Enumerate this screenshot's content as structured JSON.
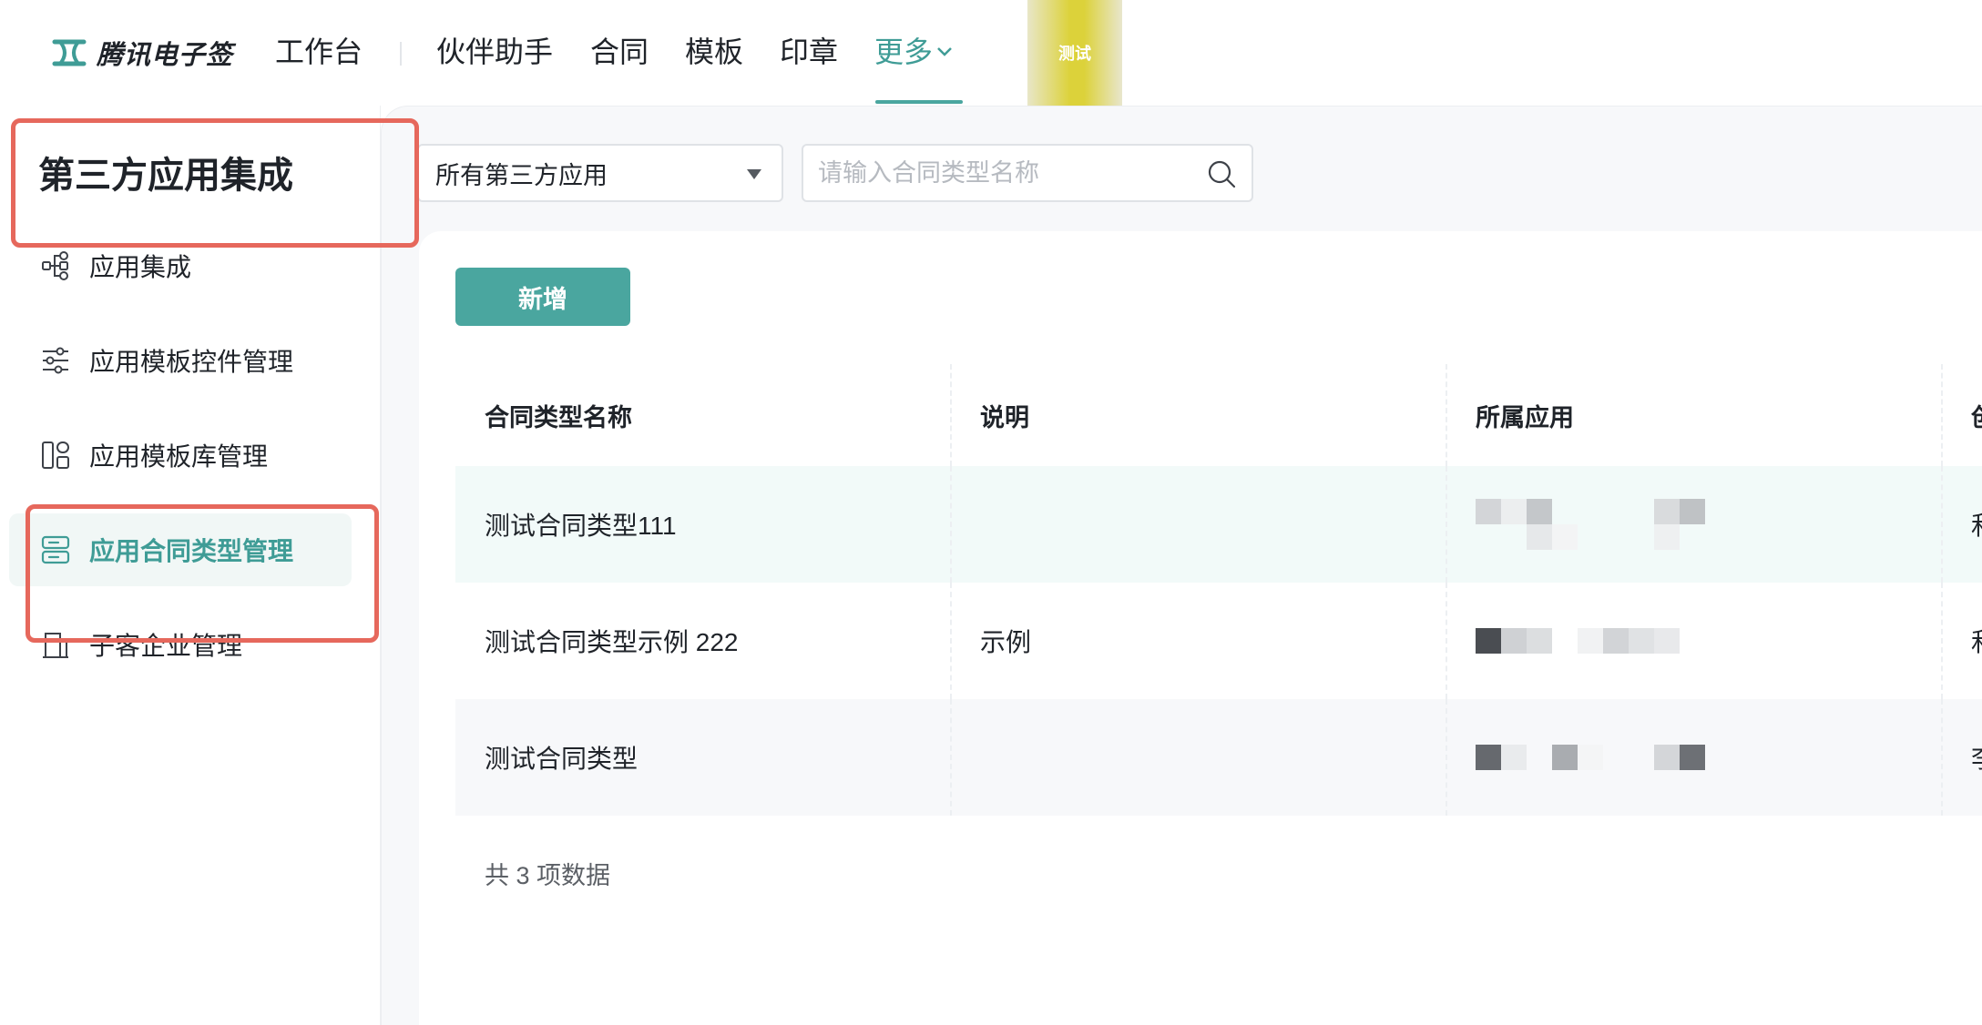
{
  "brand": {
    "name": "腾讯电子签"
  },
  "nav": {
    "items": [
      {
        "label": "工作台"
      },
      {
        "label": "伙伴助手"
      },
      {
        "label": "合同"
      },
      {
        "label": "模板"
      },
      {
        "label": "印章"
      },
      {
        "label": "更多"
      }
    ],
    "active": "更多",
    "badge": "测试"
  },
  "sidebar": {
    "title": "第三方应用集成",
    "items": [
      {
        "label": "应用集成",
        "icon": "integration-icon"
      },
      {
        "label": "应用模板控件管理",
        "icon": "sliders-icon"
      },
      {
        "label": "应用模板库管理",
        "icon": "template-library-icon"
      },
      {
        "label": "应用合同类型管理",
        "icon": "contract-type-icon",
        "active": true
      },
      {
        "label": "子客企业管理",
        "icon": "building-icon"
      }
    ]
  },
  "filters": {
    "app_select": "所有第三方应用",
    "search_placeholder": "请输入合同类型名称"
  },
  "toolbar": {
    "add_label": "新增"
  },
  "table": {
    "columns": [
      "合同类型名称",
      "说明",
      "所属应用",
      "创"
    ],
    "rows": [
      {
        "name": "测试合同类型111",
        "desc": "",
        "app_masked": true,
        "extra": "和"
      },
      {
        "name": "测试合同类型示例 222",
        "desc": "示例",
        "app_masked": true,
        "extra": "和"
      },
      {
        "name": "测试合同类型",
        "desc": "",
        "app_masked": true,
        "extra": "李"
      }
    ]
  },
  "footer": {
    "count_text": "共 3 项数据"
  },
  "colors": {
    "accent": "#4aa69f",
    "accent_text": "#3f9c96",
    "annotation": "#e6685c"
  }
}
